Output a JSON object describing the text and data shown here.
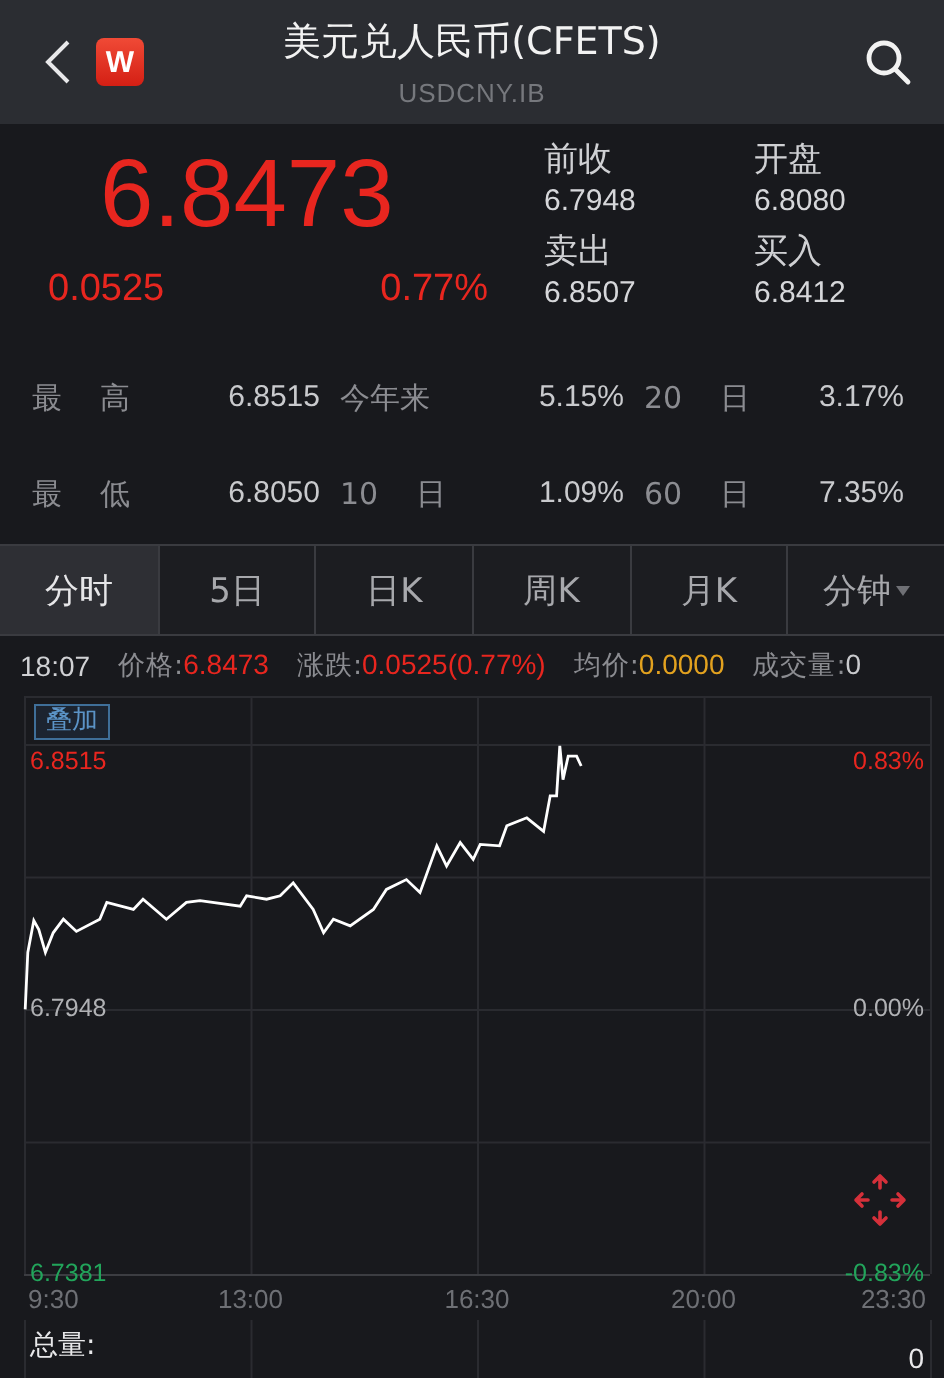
{
  "header": {
    "title": "美元兑人民币(CFETS)",
    "subtitle": "USDCNY.IB",
    "badge": "W"
  },
  "quote": {
    "price": "6.8473",
    "change": "0.0525",
    "change_percent": "0.77%",
    "color": "#e8261f",
    "fields": [
      {
        "label": "前收",
        "value": "6.7948"
      },
      {
        "label": "开盘",
        "value": "6.8080"
      },
      {
        "label": "卖出",
        "value": "6.8507"
      },
      {
        "label": "买入",
        "value": "6.8412"
      }
    ]
  },
  "stats": [
    [
      {
        "label": "最 高",
        "value": "6.8515"
      },
      {
        "label": "今年来",
        "value": "5.15%"
      },
      {
        "label": "20 日",
        "value": "3.17%"
      }
    ],
    [
      {
        "label": "最 低",
        "value": "6.8050"
      },
      {
        "label": "10 日",
        "value": "1.09%"
      },
      {
        "label": "60 日",
        "value": "7.35%"
      }
    ]
  ],
  "tabs": [
    {
      "label": "分时",
      "selected": true,
      "has_menu": false
    },
    {
      "label": "5日",
      "selected": false,
      "has_menu": false
    },
    {
      "label": "日K",
      "selected": false,
      "has_menu": false
    },
    {
      "label": "周K",
      "selected": false,
      "has_menu": false
    },
    {
      "label": "月K",
      "selected": false,
      "has_menu": false
    },
    {
      "label": "分钟",
      "selected": false,
      "has_menu": true
    }
  ],
  "info_line": {
    "time": "18:07",
    "items": [
      {
        "label": "价格:",
        "value": "6.8473",
        "color": "#e8261f"
      },
      {
        "label": "涨跌:",
        "value": "0.0525(0.77%)",
        "color": "#e8261f"
      },
      {
        "label": "均价:",
        "value": "0.0000",
        "color": "#e3a21f"
      },
      {
        "label": "成交量:",
        "value": "0",
        "color": "#c9cacd"
      }
    ]
  },
  "chart": {
    "overlay_button": "叠加",
    "levels": [
      {
        "kind": "up",
        "percent": "0.83%"
      },
      {
        "kind": "flat",
        "percent": "0.00%"
      },
      {
        "kind": "down",
        "percent": "-0.83%"
      }
    ],
    "chart_data": {
      "type": "line",
      "grid": true,
      "xlim": [
        9.5,
        23.5
      ],
      "ylim": [
        6.7381,
        6.8515
      ],
      "xticks": [
        {
          "value": 9.5,
          "label": "9:30"
        },
        {
          "value": 13,
          "label": "13:00"
        },
        {
          "value": 16.5,
          "label": "16:30"
        },
        {
          "value": 20,
          "label": "20:00"
        },
        {
          "value": 23.5,
          "label": "23:30"
        }
      ],
      "yticks": [
        {
          "value": 6.8515,
          "label": "6.8515"
        },
        {
          "value": 6.7948,
          "label": "6.7948"
        },
        {
          "value": 6.7381,
          "label": "6.7381"
        }
      ],
      "x": [
        9.52,
        9.56,
        9.65,
        9.73,
        9.83,
        9.95,
        10.11,
        10.31,
        10.67,
        10.78,
        11.19,
        11.34,
        11.7,
        12.01,
        12.22,
        12.84,
        12.94,
        13.25,
        13.46,
        13.66,
        13.97,
        14.13,
        14.28,
        14.54,
        14.9,
        15.1,
        15.41,
        15.62,
        15.88,
        16.03,
        16.24,
        16.44,
        16.55,
        16.85,
        16.96,
        17.27,
        17.53,
        17.63,
        17.73,
        17.78,
        17.83,
        17.91,
        18.04,
        18.11
      ],
      "series": [
        {
          "color": "#ffffff",
          "values": [
            6.7947,
            6.8069,
            6.8137,
            6.8118,
            6.8069,
            6.8111,
            6.814,
            6.8114,
            6.814,
            6.8176,
            6.8161,
            6.8183,
            6.814,
            6.8176,
            6.818,
            6.8168,
            6.819,
            6.8183,
            6.819,
            6.8218,
            6.8161,
            6.8111,
            6.814,
            6.8126,
            6.8161,
            6.8204,
            6.8225,
            6.8197,
            6.8297,
            6.8254,
            6.8304,
            6.8268,
            6.83,
            6.8297,
            6.834,
            6.8357,
            6.8328,
            6.8404,
            6.8404,
            6.8511,
            6.8439,
            6.8489,
            6.8489,
            6.8468
          ]
        }
      ]
    }
  },
  "volume": {
    "label": "总量:",
    "value": "0"
  }
}
